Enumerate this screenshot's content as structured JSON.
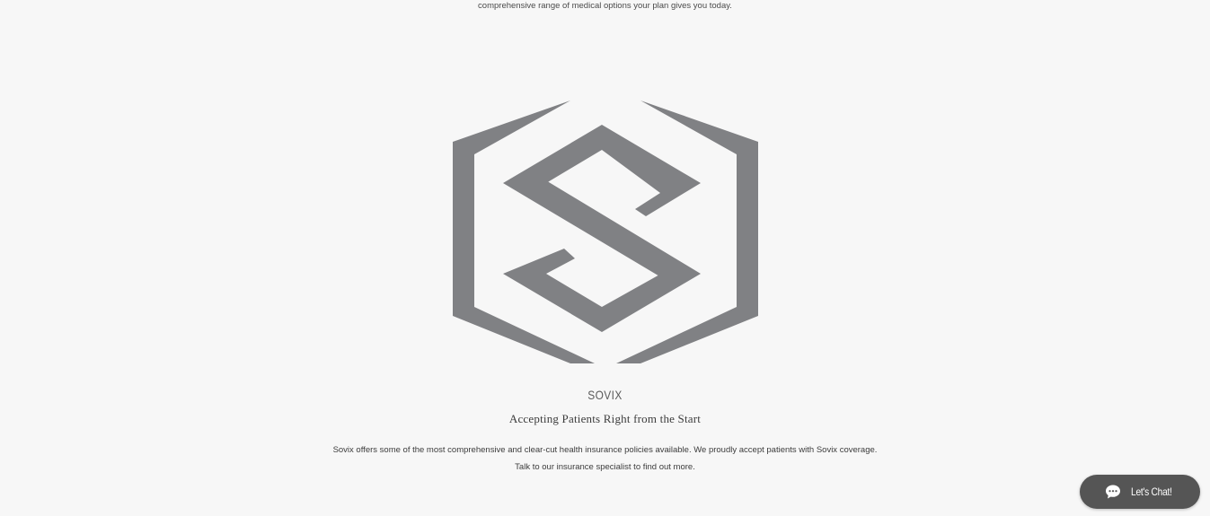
{
  "intro": {
    "text": "comprehensive range of medical options your plan gives you today."
  },
  "logo": {
    "icon": "sovix-hexagon-s-logo",
    "color": "#808184"
  },
  "card": {
    "brand": "SOVIX",
    "headline": "Accepting Patients Right from the Start",
    "description": "Sovix offers some of the most comprehensive and clear-cut health insurance policies available. We proudly accept patients with Sovix coverage. Talk to our insurance specialist to find out more."
  },
  "chat": {
    "label": "Let's Chat!",
    "icon": "chat-bubble-icon",
    "background": "#555555"
  }
}
